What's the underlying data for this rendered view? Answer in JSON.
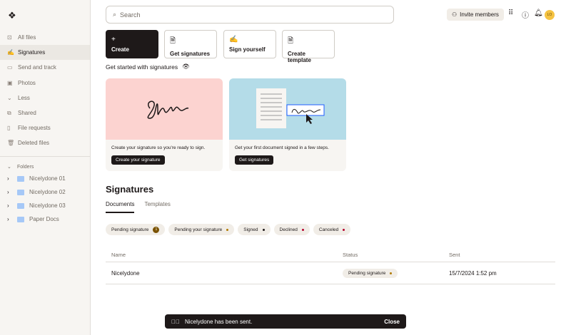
{
  "sidebar": {
    "items": [
      {
        "label": "All files",
        "icon": "people-folder-icon"
      },
      {
        "label": "Signatures",
        "icon": "signature-icon",
        "active": true
      },
      {
        "label": "Send and track",
        "icon": "send-track-icon"
      },
      {
        "label": "Photos",
        "icon": "photo-icon"
      },
      {
        "label": "Less",
        "icon": "chevron-down-icon"
      },
      {
        "label": "Shared",
        "icon": "shared-icon"
      },
      {
        "label": "File requests",
        "icon": "file-request-icon"
      },
      {
        "label": "Deleted files",
        "icon": "trash-icon"
      }
    ],
    "folders_label": "Folders",
    "folders": [
      "Nicelydone 01",
      "Nicelydone 02",
      "Nicelydone 03",
      "Paper Docs"
    ]
  },
  "header": {
    "search_placeholder": "Search",
    "invite": "Invite members",
    "avatar": "LO"
  },
  "actions": [
    "Create",
    "Get signatures",
    "Sign yourself",
    "Create template"
  ],
  "get_started": "Get started with signatures",
  "cards": [
    {
      "text": "Create your signature so you're ready to sign.",
      "button": "Create your signature",
      "color": "#fcd3d0"
    },
    {
      "text": "Get your first document signed in a few steps.",
      "button": "Get signatures",
      "color": "#b4dce8"
    }
  ],
  "section_title": "Signatures",
  "tabs": [
    "Documents",
    "Templates"
  ],
  "filters": [
    {
      "label": "Pending signature",
      "count": "1"
    },
    {
      "label": "Pending your signature",
      "dot": "#b07a00"
    },
    {
      "label": "Signed",
      "dot": "#1e1919"
    },
    {
      "label": "Declined",
      "dot": "#b4002d"
    },
    {
      "label": "Canceled",
      "dot": "#b4002d"
    }
  ],
  "table": {
    "columns": [
      "Name",
      "Status",
      "Sent"
    ],
    "rows": [
      {
        "name": "Nicelydone",
        "status": "Pending signature",
        "sent": "15/7/2024 1:52 pm"
      }
    ]
  },
  "toast": {
    "message": "Nicelydone has been sent.",
    "close": "Close"
  }
}
